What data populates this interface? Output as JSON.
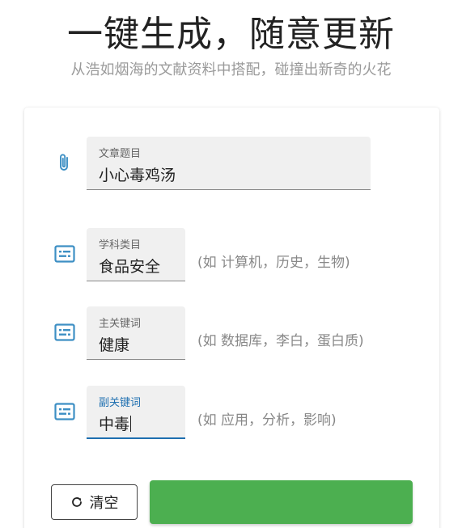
{
  "hero": {
    "title": "一键生成，随意更新",
    "subtitle": "从浩如烟海的文献资料中搭配，碰撞出新奇的火花"
  },
  "form": {
    "article_title": {
      "label": "文章题目",
      "value": "小心毒鸡汤",
      "icon": "paperclip-icon"
    },
    "subject": {
      "label": "学科类目",
      "value": "食品安全",
      "hint": "(如 计算机，历史，生物)",
      "icon": "subtitles-icon"
    },
    "main_keyword": {
      "label": "主关键词",
      "value": "健康",
      "hint": "(如 数据库，李白，蛋白质)",
      "icon": "subtitles-icon"
    },
    "sub_keyword": {
      "label": "副关键词",
      "value": "中毒",
      "hint": "(如 应用，分析，影响)",
      "icon": "subtitles-icon"
    }
  },
  "actions": {
    "clear_label": "清空",
    "clear_icon": "refresh-icon"
  },
  "colors": {
    "icon_blue": "#3d8fc4",
    "focus_blue": "#1e6fb0",
    "generate_green": "#4caf50",
    "field_bg": "#f0f0f0"
  }
}
